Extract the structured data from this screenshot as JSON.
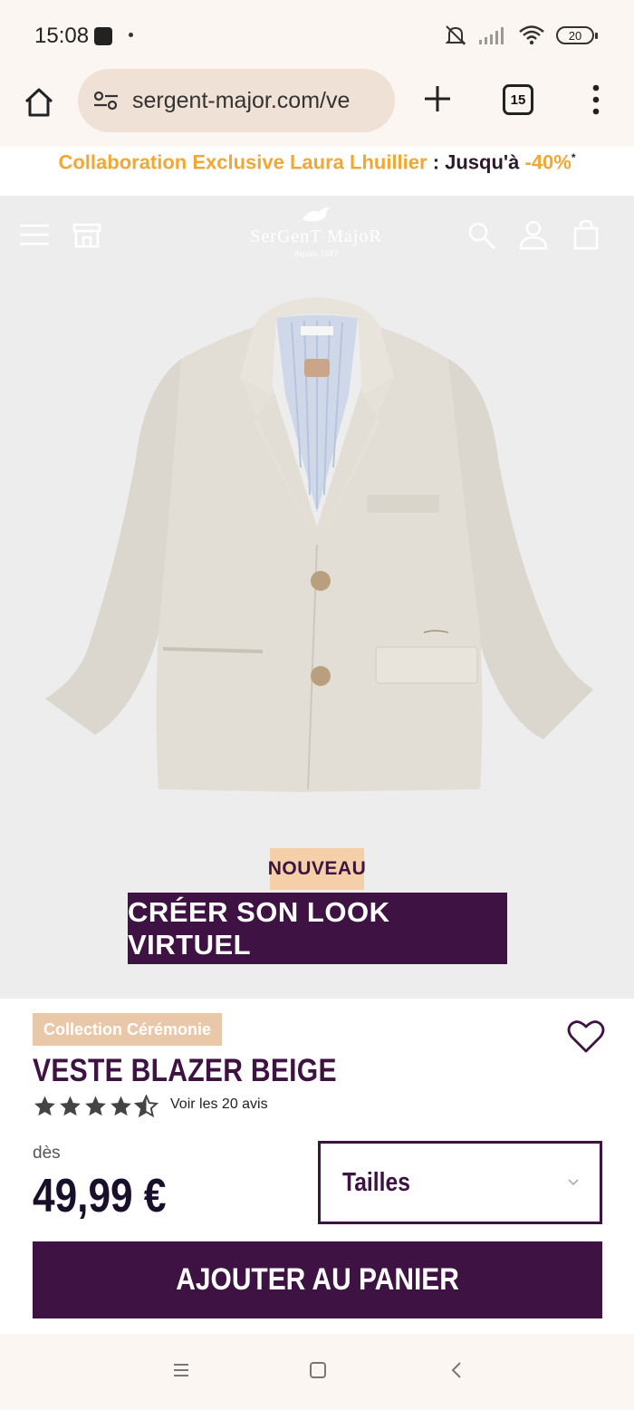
{
  "status_bar": {
    "time": "15:08",
    "battery": "20"
  },
  "browser": {
    "url": "sergent-major.com/ve",
    "tab_count": "15"
  },
  "promo": {
    "highlight": "Collaboration Exclusive Laura Lhuillier",
    "text": " : Jusqu'à ",
    "discount": "-40%",
    "note": "*"
  },
  "header": {
    "logo_name": "SerGenT MajoR",
    "logo_sub": "depuis 1987"
  },
  "hero": {
    "badge": "NOUVEAU",
    "cta": "CRÉER SON LOOK VIRTUEL"
  },
  "product": {
    "collection_tag": "Collection Cérémonie",
    "title": "VESTE BLAZER BEIGE",
    "rating": 4.5,
    "reviews_link": "Voir les 20 avis",
    "price_prefix": "dès",
    "price": "49,99 €",
    "sizes_label": "Tailles",
    "add_to_cart": "AJOUTER AU PANIER"
  },
  "colors": {
    "brand_purple": "#3e1242",
    "promo_orange": "#f3a733",
    "badge_peach": "#f4cfa8",
    "tag_tan": "#e8c8a9"
  },
  "icons": [
    "home-icon",
    "site-settings-icon",
    "plus-icon",
    "tabs-icon",
    "overflow-menu-icon",
    "hamburger-icon",
    "store-icon",
    "search-icon",
    "account-icon",
    "bag-icon",
    "heart-icon",
    "chevron-down-icon",
    "star-icon",
    "recents-icon",
    "home-nav-icon",
    "back-icon"
  ]
}
